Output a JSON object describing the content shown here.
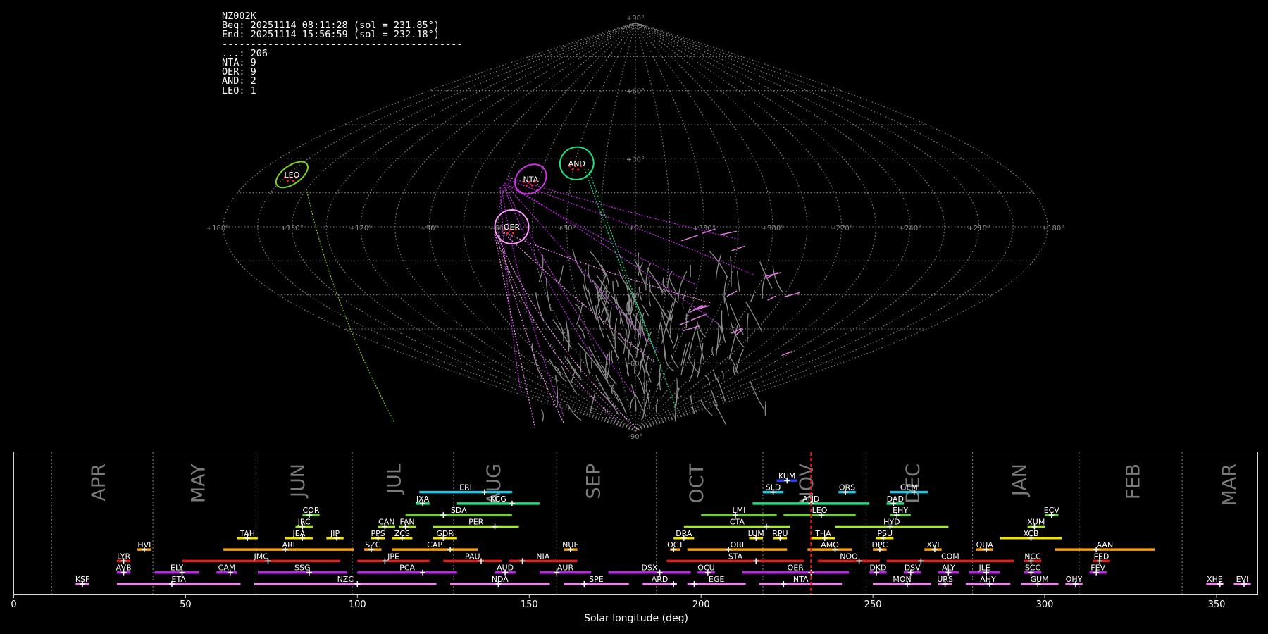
{
  "header": {
    "camera": "NZ002K",
    "begin": "Beg: 20251114 08:11:28 (sol = 231.85°)",
    "end": "End: 20251114 15:56:59 (sol = 232.18°)",
    "separator": "------------------------------------------",
    "counts": [
      {
        "text": "...: 206"
      },
      {
        "text": "NTA: 9"
      },
      {
        "text": "OER: 9"
      },
      {
        "text": "AND: 2"
      },
      {
        "text": "LEO: 1"
      }
    ]
  },
  "sky_map": {
    "lon_labels": [
      "+180°",
      "+150°",
      "+120°",
      "+90°",
      "+60°",
      "+30°",
      "+0°",
      "+330°",
      "+300°",
      "+270°",
      "+240°",
      "+210°",
      "+180°"
    ],
    "lat_labels": [
      "+90°",
      "+60°",
      "+30°",
      "-30°",
      "-60°",
      "-90°"
    ],
    "radiants": [
      {
        "code": "LEO",
        "lon": 163,
        "lat": 23,
        "color": "#7cd320"
      },
      {
        "code": "NTA",
        "lon": 49,
        "lat": 21,
        "color": "#d22fe6"
      },
      {
        "code": "AND",
        "lon": 29,
        "lat": 28,
        "color": "#19e37e"
      },
      {
        "code": "OER",
        "lon": 54,
        "lat": 0,
        "color": "#ff99ff"
      }
    ]
  },
  "chart_data": {
    "type": "timeline",
    "xlabel": "Solar longitude (deg)",
    "xlim": [
      0,
      362
    ],
    "xticks": [
      0,
      50,
      100,
      150,
      200,
      250,
      300,
      350
    ],
    "month_boundaries": [
      11,
      40.5,
      70.5,
      98.5,
      128,
      158,
      187,
      218,
      248,
      279,
      310,
      340
    ],
    "months": [
      {
        "name": "APR",
        "sol": 25
      },
      {
        "name": "MAY",
        "sol": 54
      },
      {
        "name": "JUN",
        "sol": 83
      },
      {
        "name": "JUL",
        "sol": 111
      },
      {
        "name": "AUG",
        "sol": 140
      },
      {
        "name": "SEP",
        "sol": 169
      },
      {
        "name": "OCT",
        "sol": 199
      },
      {
        "name": "NOV",
        "sol": 231
      },
      {
        "name": "DEC",
        "sol": 262
      },
      {
        "name": "JAN",
        "sol": 293
      },
      {
        "name": "FEB",
        "sol": 326
      },
      {
        "name": "MAR",
        "sol": 354
      }
    ],
    "current_sol": 232,
    "showers": [
      {
        "code": "KSF",
        "row": 0,
        "start": 18,
        "end": 22,
        "peak": 20,
        "color": "#ee82ee"
      },
      {
        "code": "ETA",
        "row": 0,
        "start": 30,
        "end": 66,
        "peak": 46,
        "color": "#ee82ee"
      },
      {
        "code": "NZC",
        "row": 0,
        "start": 70,
        "end": 123,
        "peak": 100,
        "color": "#ee82ee"
      },
      {
        "code": "NDA",
        "row": 0,
        "start": 127,
        "end": 156,
        "peak": 141,
        "color": "#ee82ee"
      },
      {
        "code": "SPE",
        "row": 0,
        "start": 160,
        "end": 179,
        "peak": 166,
        "color": "#ee82ee"
      },
      {
        "code": "ARD",
        "row": 0,
        "start": 183,
        "end": 193,
        "peak": 192,
        "color": "#ee82ee"
      },
      {
        "code": "EGE",
        "row": 0,
        "start": 196,
        "end": 213,
        "peak": 198,
        "color": "#ee82ee"
      },
      {
        "code": "NTA",
        "row": 0,
        "start": 217,
        "end": 241,
        "peak": 224,
        "color": "#ee82ee"
      },
      {
        "code": "MON",
        "row": 0,
        "start": 250,
        "end": 267,
        "peak": 260,
        "color": "#ee82ee"
      },
      {
        "code": "URS",
        "row": 0,
        "start": 269,
        "end": 273,
        "peak": 271,
        "color": "#ee82ee"
      },
      {
        "code": "AHY",
        "row": 0,
        "start": 277,
        "end": 290,
        "peak": 284,
        "color": "#ee82ee"
      },
      {
        "code": "GUM",
        "row": 0,
        "start": 293,
        "end": 304,
        "peak": 298,
        "color": "#ee82ee"
      },
      {
        "code": "OHY",
        "row": 0,
        "start": 306,
        "end": 311,
        "peak": 309,
        "color": "#ee82ee"
      },
      {
        "code": "XHE",
        "row": 0,
        "start": 347,
        "end": 352,
        "peak": 351,
        "color": "#ee82ee"
      },
      {
        "code": "EVI",
        "row": 0,
        "start": 355,
        "end": 360,
        "peak": 358,
        "color": "#ee82ee"
      },
      {
        "code": "AVB",
        "row": 1,
        "start": 30,
        "end": 34,
        "peak": 32,
        "color": "#c31ff0"
      },
      {
        "code": "ELY",
        "row": 1,
        "start": 41,
        "end": 54,
        "peak": 49,
        "color": "#c31ff0"
      },
      {
        "code": "CAM",
        "row": 1,
        "start": 59,
        "end": 65,
        "peak": 63,
        "color": "#c31ff0"
      },
      {
        "code": "SSG",
        "row": 1,
        "start": 71,
        "end": 97,
        "peak": 86,
        "color": "#c31ff0"
      },
      {
        "code": "PCA",
        "row": 1,
        "start": 100,
        "end": 129,
        "peak": 119,
        "color": "#c31ff0"
      },
      {
        "code": "AUD",
        "row": 1,
        "start": 140,
        "end": 146,
        "peak": 143,
        "color": "#c31ff0"
      },
      {
        "code": "AUR",
        "row": 1,
        "start": 153,
        "end": 168,
        "peak": 158,
        "color": "#c31ff0"
      },
      {
        "code": "DSX",
        "row": 1,
        "start": 173,
        "end": 197,
        "peak": 188,
        "color": "#c31ff0"
      },
      {
        "code": "OCU",
        "row": 1,
        "start": 199,
        "end": 204,
        "peak": 202,
        "color": "#c31ff0"
      },
      {
        "code": "OER",
        "row": 1,
        "start": 212,
        "end": 243,
        "peak": 232,
        "color": "#c31ff0"
      },
      {
        "code": "DKD",
        "row": 1,
        "start": 249,
        "end": 254,
        "peak": 251,
        "color": "#c31ff0"
      },
      {
        "code": "DSV",
        "row": 1,
        "start": 259,
        "end": 264,
        "peak": 261,
        "color": "#c31ff0"
      },
      {
        "code": "ALY",
        "row": 1,
        "start": 269,
        "end": 275,
        "peak": 272,
        "color": "#c31ff0"
      },
      {
        "code": "JLE",
        "row": 1,
        "start": 278,
        "end": 287,
        "peak": 283,
        "color": "#c31ff0"
      },
      {
        "code": "SCC",
        "row": 1,
        "start": 294,
        "end": 299,
        "peak": 296,
        "color": "#c31ff0"
      },
      {
        "code": "FEV",
        "row": 1,
        "start": 313,
        "end": 318,
        "peak": 315,
        "color": "#c31ff0"
      },
      {
        "code": "LYR",
        "row": 2,
        "start": 30,
        "end": 34,
        "peak": 32,
        "color": "#e41a1c"
      },
      {
        "code": "JMC",
        "row": 2,
        "start": 49,
        "end": 95,
        "peak": 74,
        "color": "#e41a1c"
      },
      {
        "code": "JPE",
        "row": 2,
        "start": 100,
        "end": 121,
        "peak": 108,
        "color": "#e41a1c"
      },
      {
        "code": "PAU",
        "row": 2,
        "start": 125,
        "end": 142,
        "peak": 136,
        "color": "#e41a1c"
      },
      {
        "code": "NIA",
        "row": 2,
        "start": 144,
        "end": 164,
        "peak": 148,
        "color": "#e41a1c"
      },
      {
        "code": "STA",
        "row": 2,
        "start": 190,
        "end": 230,
        "peak": 216,
        "color": "#e41a1c"
      },
      {
        "code": "NOO",
        "row": 2,
        "start": 234,
        "end": 252,
        "peak": 246,
        "color": "#e41a1c"
      },
      {
        "code": "COM",
        "row": 2,
        "start": 254,
        "end": 291,
        "peak": 264,
        "color": "#e41a1c"
      },
      {
        "code": "NCC",
        "row": 2,
        "start": 294,
        "end": 299,
        "peak": 296,
        "color": "#e41a1c"
      },
      {
        "code": "FED",
        "row": 2,
        "start": 314,
        "end": 319,
        "peak": 316,
        "color": "#e41a1c"
      },
      {
        "code": "HVI",
        "row": 3,
        "start": 36,
        "end": 40,
        "peak": 38,
        "color": "#f4a015"
      },
      {
        "code": "ARI",
        "row": 3,
        "start": 61,
        "end": 99,
        "peak": 79,
        "color": "#f4a015"
      },
      {
        "code": "SZC",
        "row": 3,
        "start": 102,
        "end": 107,
        "peak": 104,
        "color": "#f4a015"
      },
      {
        "code": "CAP",
        "row": 3,
        "start": 110,
        "end": 135,
        "peak": 127,
        "color": "#f4a015"
      },
      {
        "code": "NUE",
        "row": 3,
        "start": 160,
        "end": 164,
        "peak": 162,
        "color": "#f4a015"
      },
      {
        "code": "OCT",
        "row": 3,
        "start": 191,
        "end": 194,
        "peak": 192,
        "color": "#f4a015"
      },
      {
        "code": "ORI",
        "row": 3,
        "start": 196,
        "end": 225,
        "peak": 208,
        "color": "#f4a015"
      },
      {
        "code": "AMO",
        "row": 3,
        "start": 231,
        "end": 244,
        "peak": 239,
        "color": "#f4a015"
      },
      {
        "code": "DPC",
        "row": 3,
        "start": 250,
        "end": 254,
        "peak": 252,
        "color": "#f4a015"
      },
      {
        "code": "XVI",
        "row": 3,
        "start": 265,
        "end": 270,
        "peak": 268,
        "color": "#f4a015"
      },
      {
        "code": "QUA",
        "row": 3,
        "start": 280,
        "end": 285,
        "peak": 283,
        "color": "#f4a015"
      },
      {
        "code": "AAN",
        "row": 3,
        "start": 303,
        "end": 332,
        "peak": 315,
        "color": "#f4a015"
      },
      {
        "code": "TAH",
        "row": 4,
        "start": 65,
        "end": 71,
        "peak": 68,
        "color": "#f1e01c"
      },
      {
        "code": "JEA",
        "row": 4,
        "start": 79,
        "end": 87,
        "peak": 84,
        "color": "#f1e01c"
      },
      {
        "code": "JIP",
        "row": 4,
        "start": 91,
        "end": 96,
        "peak": 94,
        "color": "#f1e01c"
      },
      {
        "code": "PPS",
        "row": 4,
        "start": 104,
        "end": 108,
        "peak": 106,
        "color": "#f1e01c"
      },
      {
        "code": "ZCS",
        "row": 4,
        "start": 110,
        "end": 116,
        "peak": 113,
        "color": "#f1e01c"
      },
      {
        "code": "GDR",
        "row": 4,
        "start": 122,
        "end": 129,
        "peak": 125,
        "color": "#f1e01c"
      },
      {
        "code": "DRA",
        "row": 4,
        "start": 192,
        "end": 198,
        "peak": 195,
        "color": "#f1e01c"
      },
      {
        "code": "LUM",
        "row": 4,
        "start": 214,
        "end": 218,
        "peak": 216,
        "color": "#f1e01c"
      },
      {
        "code": "RPU",
        "row": 4,
        "start": 221,
        "end": 225,
        "peak": 223,
        "color": "#f1e01c"
      },
      {
        "code": "THA",
        "row": 4,
        "start": 232,
        "end": 239,
        "peak": 236,
        "color": "#f1e01c"
      },
      {
        "code": "PSU",
        "row": 4,
        "start": 251,
        "end": 256,
        "peak": 253,
        "color": "#f1e01c"
      },
      {
        "code": "XCB",
        "row": 4,
        "start": 287,
        "end": 305,
        "peak": 296,
        "color": "#f1e01c"
      },
      {
        "code": "JRC",
        "row": 5,
        "start": 82,
        "end": 87,
        "peak": 84,
        "color": "#a6e63b"
      },
      {
        "code": "CAN",
        "row": 5,
        "start": 106,
        "end": 111,
        "peak": 108,
        "color": "#a6e63b"
      },
      {
        "code": "FAN",
        "row": 5,
        "start": 112,
        "end": 117,
        "peak": 114,
        "color": "#a6e63b"
      },
      {
        "code": "PER",
        "row": 5,
        "start": 122,
        "end": 147,
        "peak": 140,
        "color": "#a6e63b"
      },
      {
        "code": "CTA",
        "row": 5,
        "start": 195,
        "end": 226,
        "peak": 219,
        "color": "#a6e63b"
      },
      {
        "code": "HYD",
        "row": 5,
        "start": 239,
        "end": 272,
        "peak": 255,
        "color": "#a6e63b"
      },
      {
        "code": "XUM",
        "row": 5,
        "start": 295,
        "end": 300,
        "peak": 297,
        "color": "#a6e63b"
      },
      {
        "code": "COR",
        "row": 6,
        "start": 84,
        "end": 89,
        "peak": 86,
        "color": "#6ad13a"
      },
      {
        "code": "SDA",
        "row": 6,
        "start": 114,
        "end": 145,
        "peak": 125,
        "color": "#6ad13a"
      },
      {
        "code": "LMI",
        "row": 6,
        "start": 200,
        "end": 222,
        "peak": 210,
        "color": "#6ad13a"
      },
      {
        "code": "LEO",
        "row": 6,
        "start": 224,
        "end": 245,
        "peak": 235,
        "color": "#6ad13a"
      },
      {
        "code": "EHY",
        "row": 6,
        "start": 255,
        "end": 261,
        "peak": 257,
        "color": "#6ad13a"
      },
      {
        "code": "ECV",
        "row": 6,
        "start": 300,
        "end": 304,
        "peak": 302,
        "color": "#6ad13a"
      },
      {
        "code": "JXA",
        "row": 7,
        "start": 117,
        "end": 121,
        "peak": 119,
        "color": "#19e37e"
      },
      {
        "code": "KCG",
        "row": 7,
        "start": 129,
        "end": 153,
        "peak": 145,
        "color": "#19e37e"
      },
      {
        "code": "AND",
        "row": 7,
        "start": 215,
        "end": 249,
        "peak": 232,
        "color": "#19e37e"
      },
      {
        "code": "DAD",
        "row": 7,
        "start": 254,
        "end": 259,
        "peak": 256,
        "color": "#19e37e"
      },
      {
        "code": "ERI",
        "row": 8,
        "start": 118,
        "end": 145,
        "peak": 137,
        "color": "#19c9e6"
      },
      {
        "code": "SLD",
        "row": 8,
        "start": 218,
        "end": 224,
        "peak": 221,
        "color": "#19c9e6"
      },
      {
        "code": "ORS",
        "row": 8,
        "start": 240,
        "end": 245,
        "peak": 242,
        "color": "#19c9e6"
      },
      {
        "code": "GEM",
        "row": 8,
        "start": 255,
        "end": 266,
        "peak": 262,
        "color": "#19c9e6"
      },
      {
        "code": "KUM",
        "row": 9,
        "start": 222,
        "end": 228,
        "peak": 225,
        "color": "#2a44e8"
      }
    ]
  }
}
